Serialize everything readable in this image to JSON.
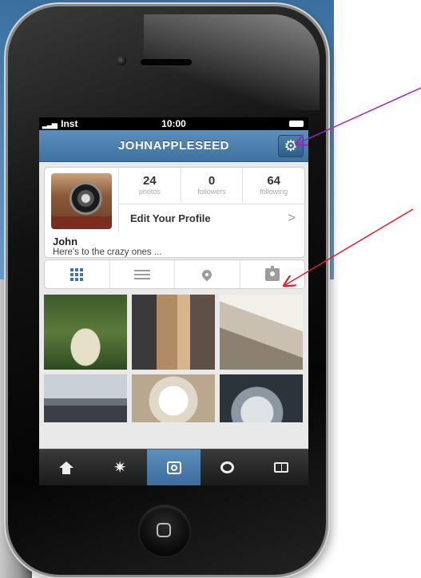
{
  "status_bar": {
    "carrier": "Inst",
    "time": "10:00"
  },
  "nav_bar": {
    "title": "JOHNAPPLESEED",
    "settings_icon": "gear-icon"
  },
  "profile": {
    "stats": [
      {
        "value": "24",
        "label": "photos"
      },
      {
        "value": "0",
        "label": "followers"
      },
      {
        "value": "64",
        "label": "following"
      }
    ],
    "edit_label": "Edit Your Profile",
    "edit_chevron": ">",
    "name": "John",
    "bio": "Here's to the crazy ones ..."
  },
  "view_tabs": [
    {
      "icon": "grid-icon",
      "selected": true
    },
    {
      "icon": "list-icon",
      "selected": false
    },
    {
      "icon": "location-pin-icon",
      "selected": false
    },
    {
      "icon": "tagged-photos-icon",
      "selected": false
    }
  ],
  "tab_bar": [
    {
      "icon": "home-icon",
      "active": false
    },
    {
      "icon": "explore-star-icon",
      "active": false
    },
    {
      "icon": "camera-icon",
      "active": true
    },
    {
      "icon": "news-bubble-icon",
      "active": false
    },
    {
      "icon": "profile-card-icon",
      "active": false
    }
  ],
  "colors": {
    "nav_blue": "#4a7eae",
    "annotation_purple": "#9b2ab8",
    "annotation_red": "#e0202a"
  }
}
